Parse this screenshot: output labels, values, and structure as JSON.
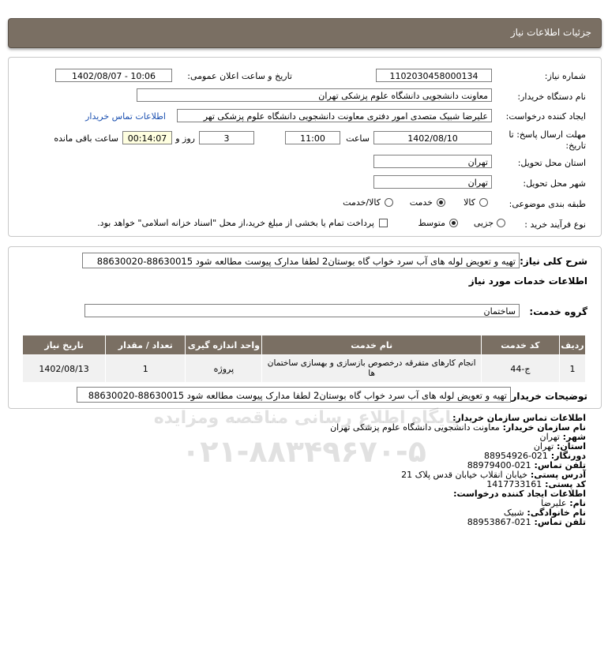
{
  "header": {
    "title": "جزئیات اطلاعات نیاز"
  },
  "form": {
    "need_number_label": "شماره نیاز:",
    "need_number": "1102030458000134",
    "announce_label": "تاریخ و ساعت اعلان عمومی:",
    "announce_value": "1402/08/07 - 10:06",
    "buyer_org_label": "نام دستگاه خریدار:",
    "buyer_org": "معاونت دانشجویی دانشگاه علوم پزشکی تهران",
    "creator_label": "ایجاد کننده درخواست:",
    "creator": "علیرضا شبیک متصدی امور دفتری معاونت دانشجویی دانشگاه علوم پزشکی تهر",
    "contact_link": "اطلاعات تماس خریدار",
    "deadline_label_1": "مهلت ارسال پاسخ: تا",
    "deadline_label_2": "تاریخ:",
    "deadline_date": "1402/08/10",
    "time_label": "ساعت",
    "deadline_time": "11:00",
    "days": "3",
    "days_label": "روز و",
    "remaining": "00:14:07",
    "remaining_label": "ساعت باقی مانده",
    "province_label": "استان محل تحویل:",
    "province": "تهران",
    "city_label": "شهر محل تحویل:",
    "city": "تهران",
    "category_label": "طبقه بندی موضوعی:",
    "category_options": [
      "کالا",
      "خدمت",
      "کالا/خدمت"
    ],
    "category_selected": "خدمت",
    "process_label": "نوع فرآیند خرید :",
    "process_options": [
      "جزیی",
      "متوسط"
    ],
    "process_selected": "متوسط",
    "payment_text": "پرداخت تمام یا بخشی از مبلغ خرید،از محل \"اسناد خزانه اسلامی\" خواهد بود."
  },
  "summary": {
    "label": "شرح کلی نیاز:",
    "text": "تهیه و تعویض لوله های آب سرد خواب گاه بوستان2 لطفا مدارک پیوست مطالعه شود 88630015-88630020"
  },
  "services": {
    "section_title": "اطلاعات خدمات مورد نیاز",
    "group_label": "گروه خدمت:",
    "group_value": "ساختمان",
    "columns": [
      "ردیف",
      "کد خدمت",
      "نام خدمت",
      "واحد اندازه گیری",
      "تعداد / مقدار",
      "تاریخ نیاز"
    ],
    "rows": [
      {
        "row": "1",
        "code": "ج-44",
        "name_line1": "انجام کارهای متفرقه درخصوص بازسازی و بهسازی ساختمان",
        "name_line2": "ها",
        "unit": "پروژه",
        "qty": "1",
        "date": "1402/08/13"
      }
    ]
  },
  "buyer_notes": {
    "label": "توضیحات خریدار:",
    "text": "تهیه و تعویض لوله های آب سرد خواب گاه بوستان2 لطفا مدارک پیوست مطالعه شود 88630015-88630020"
  },
  "contact": {
    "title": "اطلاعات تماس سازمان خریدار:",
    "org_label": "نام سازمان خریدار:",
    "org": "معاونت دانشجویی دانشگاه علوم پزشکی تهران",
    "city_label": "شهر:",
    "city": "تهران",
    "province_label": "استان:",
    "province": "تهران",
    "fax_label": "دورنگار:",
    "fax": "021-88954926",
    "phone_label": "تلفن تماس:",
    "phone": "021-88979400",
    "address_label": "آدرس پستی:",
    "address": "خیابان انقلاب خیابان قدس پلاک 21",
    "postal_label": "کد پستی:",
    "postal": "1417733161",
    "creator_title": "اطلاعات ایجاد کننده درخواست:",
    "name_label": "نام:",
    "name": "علیرضا",
    "family_label": "نام خانوادگی:",
    "family": "شبیک",
    "creator_phone_label": "تلفن تماس:",
    "creator_phone": "021-88953867"
  },
  "watermark": {
    "line1": "پایگاه اطلاع رسانی مناقصه ومزایده",
    "line2": "۰۲۱-۸۸۳۴۹۶۷۰-۵"
  }
}
